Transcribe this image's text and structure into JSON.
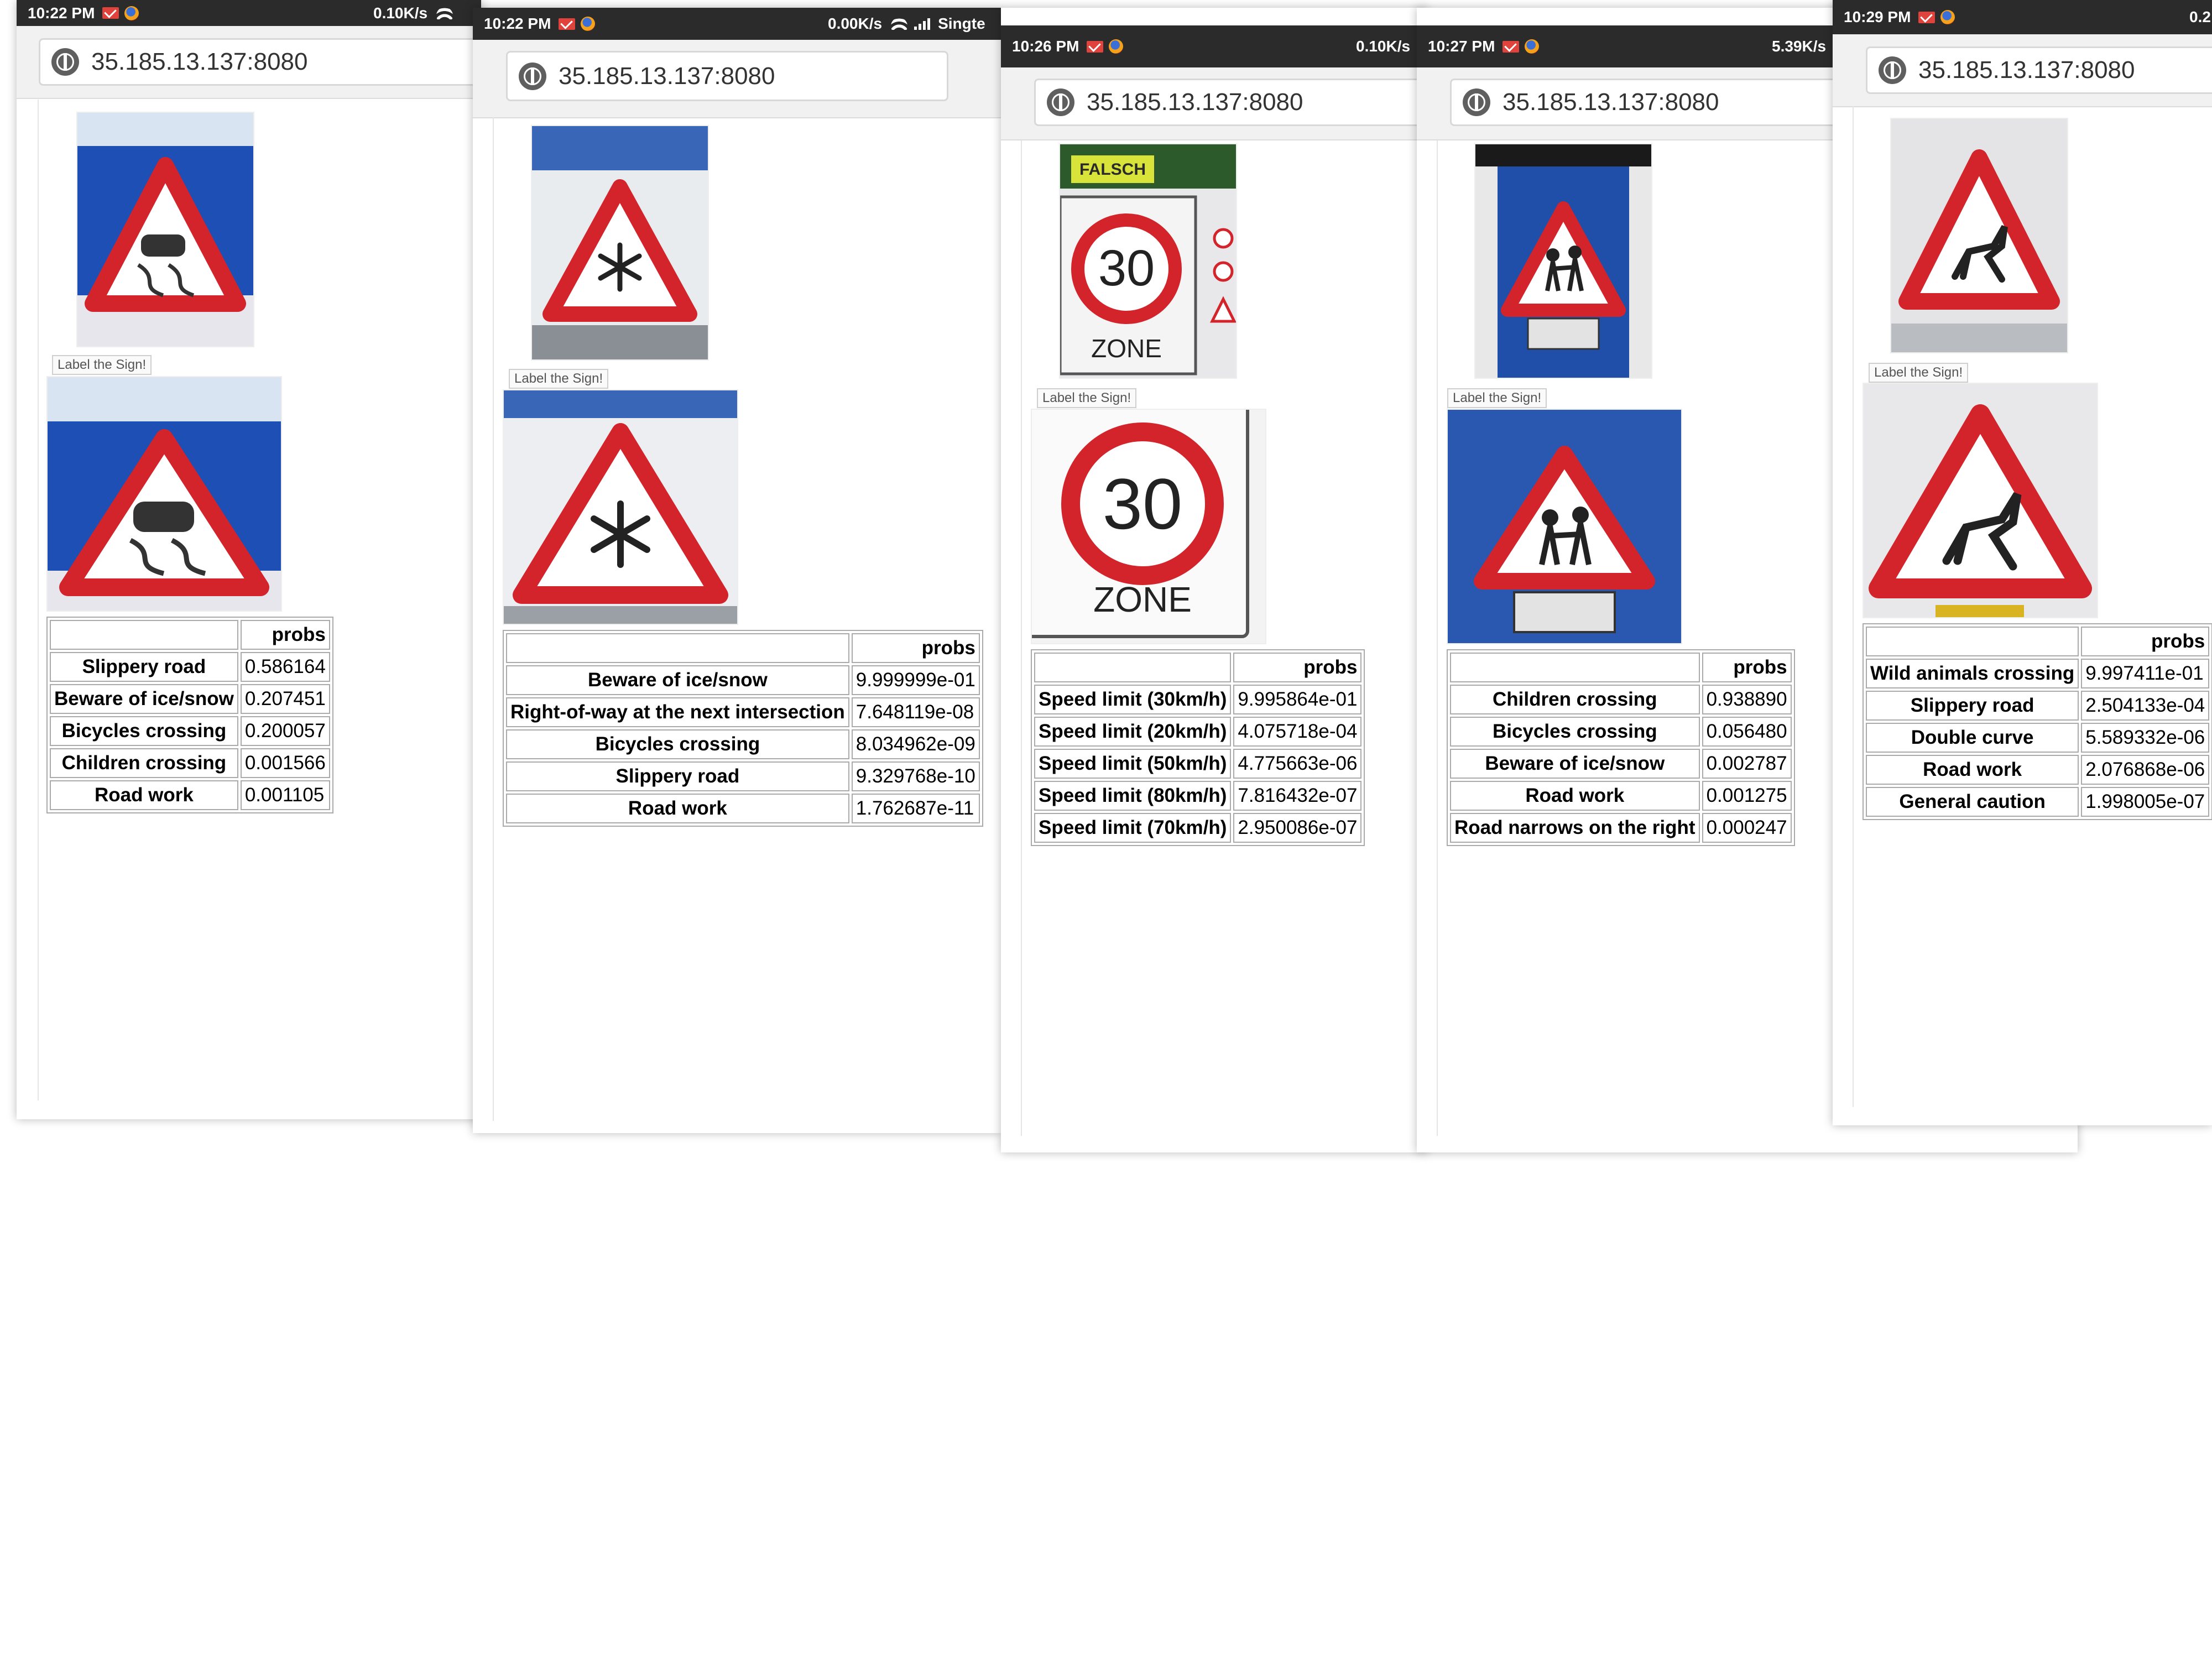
{
  "screens": [
    {
      "status": {
        "time": "10:22 PM",
        "speed": "0.10K/s",
        "carrier": ""
      },
      "url": "35.185.13.137:8080",
      "sign_kind": "slippery",
      "label_button": "Label the Sign!",
      "table_header": "probs",
      "predictions": [
        {
          "label": "Slippery road",
          "prob": "0.586164"
        },
        {
          "label": "Beware of ice/snow",
          "prob": "0.207451"
        },
        {
          "label": "Bicycles crossing",
          "prob": "0.200057"
        },
        {
          "label": "Children crossing",
          "prob": "0.001566"
        },
        {
          "label": "Road work",
          "prob": "0.001105"
        }
      ]
    },
    {
      "status": {
        "time": "10:22 PM",
        "speed": "0.00K/s",
        "carrier": "Singte"
      },
      "url": "35.185.13.137:8080",
      "sign_kind": "snow",
      "label_button": "Label the Sign!",
      "table_header": "probs",
      "predictions": [
        {
          "label": "Beware of ice/snow",
          "prob": "9.999999e-01"
        },
        {
          "label": "Right-of-way at the next intersection",
          "prob": "7.648119e-08"
        },
        {
          "label": "Bicycles crossing",
          "prob": "8.034962e-09"
        },
        {
          "label": "Slippery road",
          "prob": "9.329768e-10"
        },
        {
          "label": "Road work",
          "prob": "1.762687e-11"
        }
      ]
    },
    {
      "status": {
        "time": "10:26 PM",
        "speed": "0.10K/s",
        "carrier": ""
      },
      "url": "35.185.13.137:8080",
      "sign_kind": "zone30",
      "sign_text": {
        "number": "30",
        "word": "ZONE",
        "top": "FALSCH"
      },
      "label_button": "Label the Sign!",
      "table_header": "probs",
      "predictions": [
        {
          "label": "Speed limit (30km/h)",
          "prob": "9.995864e-01"
        },
        {
          "label": "Speed limit (20km/h)",
          "prob": "4.075718e-04"
        },
        {
          "label": "Speed limit (50km/h)",
          "prob": "4.775663e-06"
        },
        {
          "label": "Speed limit (80km/h)",
          "prob": "7.816432e-07"
        },
        {
          "label": "Speed limit (70km/h)",
          "prob": "2.950086e-07"
        }
      ]
    },
    {
      "status": {
        "time": "10:27 PM",
        "speed": "5.39K/s",
        "carrier": ""
      },
      "url": "35.185.13.137:8080",
      "sign_kind": "children",
      "label_button": "Label the Sign!",
      "table_header": "probs",
      "predictions": [
        {
          "label": "Children crossing",
          "prob": "0.938890"
        },
        {
          "label": "Bicycles crossing",
          "prob": "0.056480"
        },
        {
          "label": "Beware of ice/snow",
          "prob": "0.002787"
        },
        {
          "label": "Road work",
          "prob": "0.001275"
        },
        {
          "label": "Road narrows on the right",
          "prob": "0.000247"
        }
      ]
    },
    {
      "status": {
        "time": "10:29 PM",
        "speed": "0.2",
        "carrier": ""
      },
      "url": "35.185.13.137:8080",
      "sign_kind": "deer",
      "label_button": "Label the Sign!",
      "table_header": "probs",
      "predictions": [
        {
          "label": "Wild animals crossing",
          "prob": "9.997411e-01"
        },
        {
          "label": "Slippery road",
          "prob": "2.504133e-04"
        },
        {
          "label": "Double curve",
          "prob": "5.589332e-06"
        },
        {
          "label": "Road work",
          "prob": "2.076868e-06"
        },
        {
          "label": "General caution",
          "prob": "1.998005e-07"
        }
      ]
    }
  ]
}
